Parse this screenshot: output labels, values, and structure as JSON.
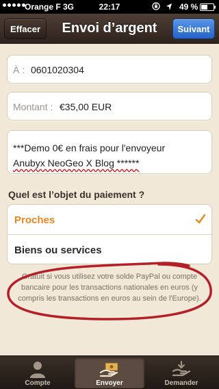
{
  "status_bar": {
    "carrier": "Orange F",
    "network": "3G",
    "time": "22:17",
    "battery": "49 %"
  },
  "nav": {
    "cancel_label": "Effacer",
    "title": "Envoi d’argent",
    "next_label": "Suivant"
  },
  "form": {
    "to_label": "À :",
    "to_value": "0601020304",
    "amount_label": "Montant :",
    "amount_value": "€35,00 EUR",
    "message_line1": "***Demo 0€ en frais pour l'envoyeur",
    "message_line2": "Anubyx NeoGeo X Blog ******"
  },
  "payment": {
    "question": "Quel est l’objet du paiement ?",
    "options": [
      {
        "label": "Proches",
        "selected": true
      },
      {
        "label": "Biens ou services",
        "selected": false
      }
    ],
    "info": "Gratuit si vous utilisez votre solde PayPal ou compte bancaire pour les transactions nationales en euros (y compris les transactions en euros au sein de l'Europe)."
  },
  "tabs": [
    {
      "label": "Compte",
      "icon": "person-icon",
      "active": false
    },
    {
      "label": "Envoyer",
      "icon": "send-money-icon",
      "active": true
    },
    {
      "label": "Demander",
      "icon": "request-money-icon",
      "active": false
    }
  ],
  "colors": {
    "accent": "#e8861f",
    "primary_button": "#2463c9",
    "annotation": "#b51f28"
  }
}
